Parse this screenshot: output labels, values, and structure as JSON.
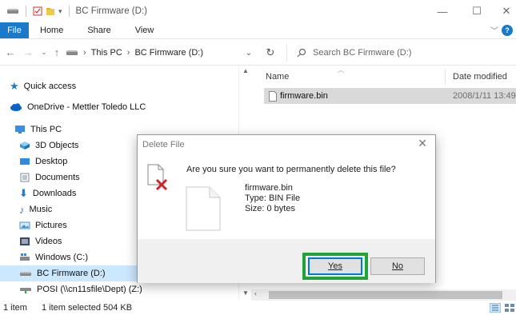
{
  "window": {
    "title": "BC Firmware (D:)",
    "minimize_glyph": "—",
    "maximize_glyph": "☐",
    "close_glyph": "✕"
  },
  "ribbon": {
    "tabs": [
      "File",
      "Home",
      "Share",
      "View"
    ],
    "expand_glyph": "﹀",
    "help_glyph": "?"
  },
  "address": {
    "path": [
      "This PC",
      "BC Firmware (D:)"
    ],
    "separator": "›",
    "search_placeholder": "Search BC Firmware (D:)"
  },
  "nav": {
    "items": [
      {
        "label": "Quick access",
        "icon": "star-icon"
      },
      {
        "label": "OneDrive - Mettler Toledo LLC",
        "icon": "cloud-icon"
      },
      {
        "label": "This PC",
        "icon": "pc-icon"
      },
      {
        "label": "3D Objects",
        "icon": "cube-icon"
      },
      {
        "label": "Desktop",
        "icon": "desktop-icon"
      },
      {
        "label": "Documents",
        "icon": "documents-icon"
      },
      {
        "label": "Downloads",
        "icon": "download-icon"
      },
      {
        "label": "Music",
        "icon": "music-icon"
      },
      {
        "label": "Pictures",
        "icon": "pictures-icon"
      },
      {
        "label": "Videos",
        "icon": "videos-icon"
      },
      {
        "label": "Windows (C:)",
        "icon": "drive-icon"
      },
      {
        "label": "BC Firmware (D:)",
        "icon": "usb-drive-icon",
        "selected": true
      },
      {
        "label": "POSI (\\\\cn11sfile\\Dept) (Z:)",
        "icon": "network-drive-icon"
      }
    ]
  },
  "filelist": {
    "columns": {
      "name": "Name",
      "date": "Date modified"
    },
    "files": [
      {
        "name": "firmware.bin",
        "date": "2008/1/11 13:49"
      }
    ]
  },
  "status": {
    "count": "1 item",
    "selection": "1 item selected 504 KB"
  },
  "dialog": {
    "title": "Delete File",
    "question": "Are you sure you want to permanently delete this file?",
    "file_name": "firmware.bin",
    "file_type": "Type: BIN File",
    "file_size": "Size: 0 bytes",
    "yes_label": "Yes",
    "no_label": "No",
    "highlight_color": "#22a33a"
  }
}
